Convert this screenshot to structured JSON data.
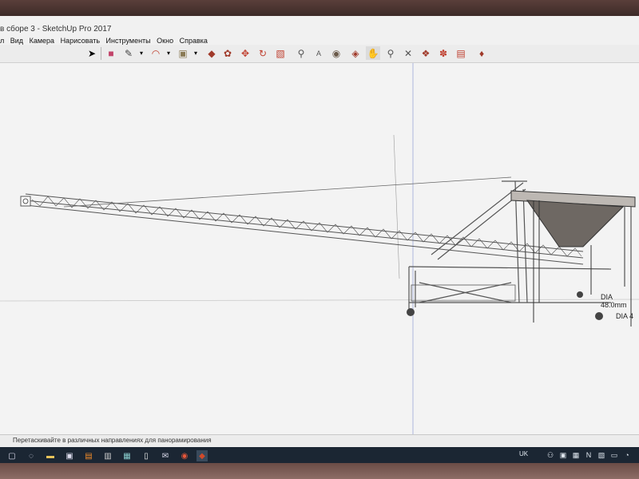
{
  "window": {
    "title": "в сборе 3 - SketchUp Pro 2017"
  },
  "menu": [
    "л",
    "Вид",
    "Камера",
    "Нарисовать",
    "Инструменты",
    "Окно",
    "Справка"
  ],
  "toolbar_icons": [
    "select-icon",
    "eraser-icon",
    "pencil-icon",
    "arc-icon",
    "paint-bucket-icon",
    "push-pull-icon",
    "follow-me-icon",
    "move-icon",
    "rotate-icon",
    "scale-icon",
    "tape-measure-icon",
    "text-icon",
    "orbit-icon",
    "pan-icon",
    "zoom-icon",
    "zoom-extents-icon",
    "components-icon",
    "materials-icon",
    "styles-icon",
    "warehouse-icon"
  ],
  "dimensions": {
    "label1": "DIA 48.0mm",
    "label2": "DIA 4"
  },
  "status": {
    "text": "Перетаскивайте в различных направлениях для панорамирования"
  },
  "tray": {
    "language": "UK"
  },
  "colors": {
    "viewport": "#f3f3f3",
    "hopper": "#6e6863",
    "axis_green": "#7fbf7f",
    "axis_blue": "#9aa7d8"
  }
}
